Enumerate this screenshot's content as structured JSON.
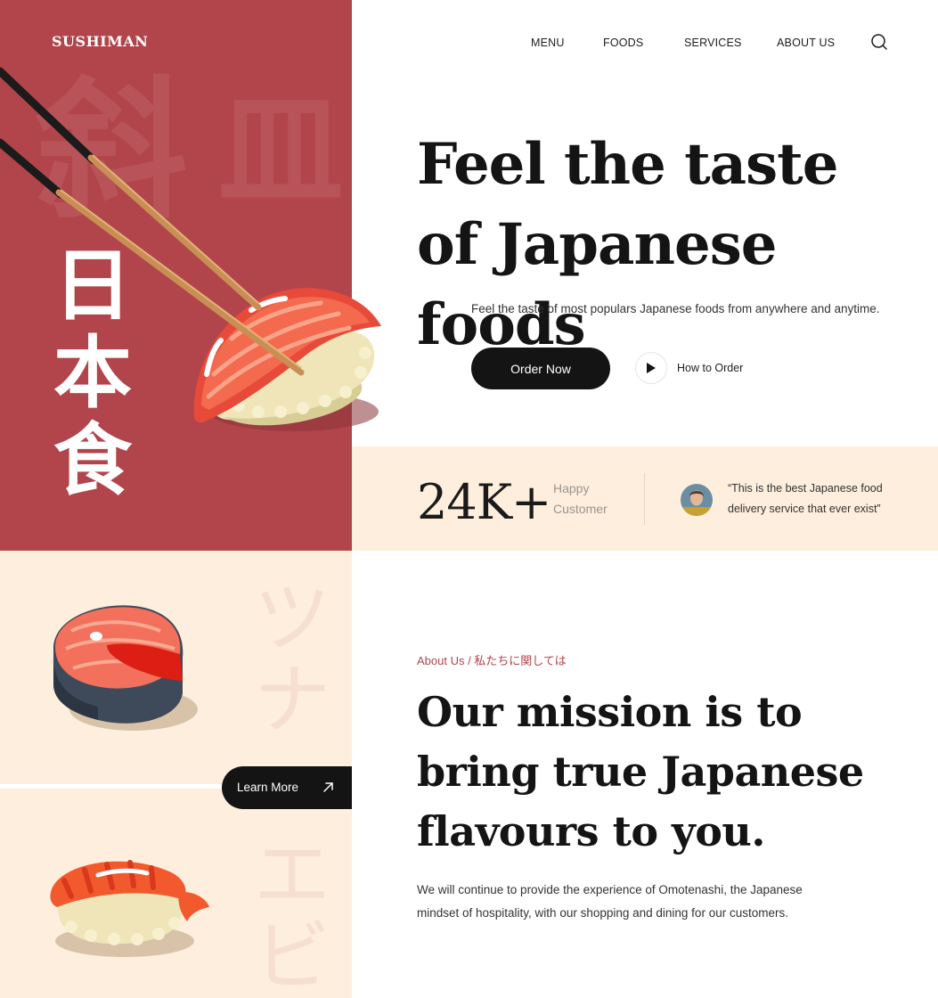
{
  "brand": {
    "logo": "SUSHIMAN"
  },
  "nav": {
    "items": [
      "MENU",
      "FOODS",
      "SERVICES",
      "ABOUT US"
    ]
  },
  "hero": {
    "kanji_vertical": [
      "日",
      "本",
      "食"
    ],
    "title": "Feel the taste of Japanese foods",
    "subtitle": "Feel the taste of most populars Japanese foods from anywhere and anytime.",
    "order_button": "Order Now",
    "how_to_order": "How to Order"
  },
  "stats": {
    "number": "24K+",
    "label": "Happy Customer",
    "testimonial": "“This is the best Japanese food delivery service that ever exist”"
  },
  "side_panel": {
    "learn_more": "Learn More"
  },
  "about": {
    "tag": "About Us / 私たちに関しては",
    "title": "Our mission is to bring true Japanese flavours to you.",
    "body": "We will continue to provide the experience of Omotenashi, the Japanese mindset of hospitality, with our shopping and dining for our customers."
  },
  "icons": {
    "search": "search-icon",
    "play": "play-icon",
    "arrow": "arrow-up-right-icon"
  },
  "colors": {
    "brand_red": "#b2454b",
    "cream": "#fdeedd",
    "dark": "#141414"
  }
}
